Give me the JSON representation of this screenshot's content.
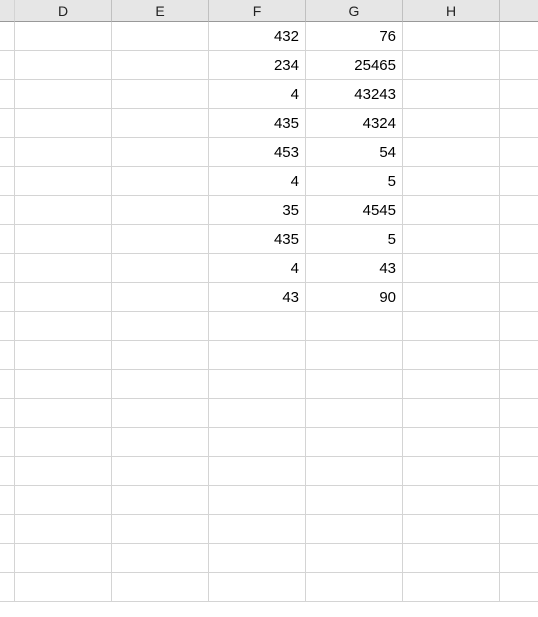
{
  "columns": [
    "D",
    "E",
    "F",
    "G",
    "H"
  ],
  "rowCount": 20,
  "cells": {
    "F": [
      "432",
      "234",
      "4",
      "435",
      "453",
      "4",
      "35",
      "435",
      "4",
      "43"
    ],
    "G": [
      "76",
      "25465",
      "43243",
      "4324",
      "54",
      "5",
      "4545",
      "5",
      "43",
      "90"
    ]
  },
  "chart_data": {
    "type": "table",
    "columns": [
      "D",
      "E",
      "F",
      "G",
      "H"
    ],
    "rows": [
      {
        "D": "",
        "E": "",
        "F": 432,
        "G": 76,
        "H": ""
      },
      {
        "D": "",
        "E": "",
        "F": 234,
        "G": 25465,
        "H": ""
      },
      {
        "D": "",
        "E": "",
        "F": 4,
        "G": 43243,
        "H": ""
      },
      {
        "D": "",
        "E": "",
        "F": 435,
        "G": 4324,
        "H": ""
      },
      {
        "D": "",
        "E": "",
        "F": 453,
        "G": 54,
        "H": ""
      },
      {
        "D": "",
        "E": "",
        "F": 4,
        "G": 5,
        "H": ""
      },
      {
        "D": "",
        "E": "",
        "F": 35,
        "G": 4545,
        "H": ""
      },
      {
        "D": "",
        "E": "",
        "F": 435,
        "G": 5,
        "H": ""
      },
      {
        "D": "",
        "E": "",
        "F": 4,
        "G": 43,
        "H": ""
      },
      {
        "D": "",
        "E": "",
        "F": 43,
        "G": 90,
        "H": ""
      }
    ]
  }
}
